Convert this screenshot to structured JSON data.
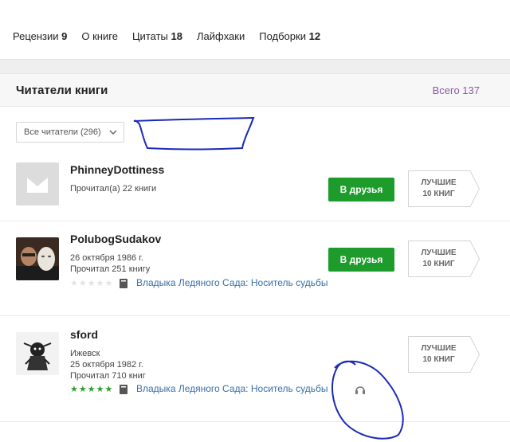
{
  "nav": {
    "tabs": [
      {
        "label": "Рецензии",
        "count": "9"
      },
      {
        "label": "О книге",
        "count": ""
      },
      {
        "label": "Цитаты",
        "count": "18"
      },
      {
        "label": "Лайфхаки",
        "count": ""
      },
      {
        "label": "Подборки",
        "count": "12"
      }
    ]
  },
  "panel": {
    "title": "Читатели книги",
    "total": "Всего 137",
    "filter_label": "Все читатели (296)"
  },
  "readers": [
    {
      "name": "PhinneyDottiness",
      "avatar": "placeholder",
      "lines": [
        "Прочитал(а) 22 книги"
      ],
      "friend_button": "В друзья",
      "best_line1": "ЛУЧШИЕ",
      "best_line2": "10 КНИГ"
    },
    {
      "name": "PolubogSudakov",
      "avatar": "photo",
      "lines": [
        "26 октября 1986 г.",
        "Прочитал 251 книгу"
      ],
      "rating_stars": "★★★★★",
      "rating": 0,
      "book": "Владыка Ледяного Сада: Носитель судьбы",
      "friend_button": "В друзья",
      "best_line1": "ЛУЧШИЕ",
      "best_line2": "10 КНИГ"
    },
    {
      "name": "sford",
      "avatar": "drawing",
      "lines": [
        "Ижевск",
        "25 октября 1982 г.",
        "Прочитал 710 книг"
      ],
      "rating_stars": "★★★★★",
      "rating": 5,
      "book": "Владыка Ледяного Сада: Носитель судьбы",
      "audio_icon": "headphones-icon",
      "best_line1": "ЛУЧШИЕ",
      "best_line2": "10 КНИГ"
    }
  ],
  "colors": {
    "friend_button": "#1d9c2c",
    "total_link": "#8a5aa6",
    "book_link": "#3a6ea5",
    "star_filled": "#2e9e2e",
    "star_empty": "#e3e3e3",
    "scribble": "#1a2ab8"
  }
}
